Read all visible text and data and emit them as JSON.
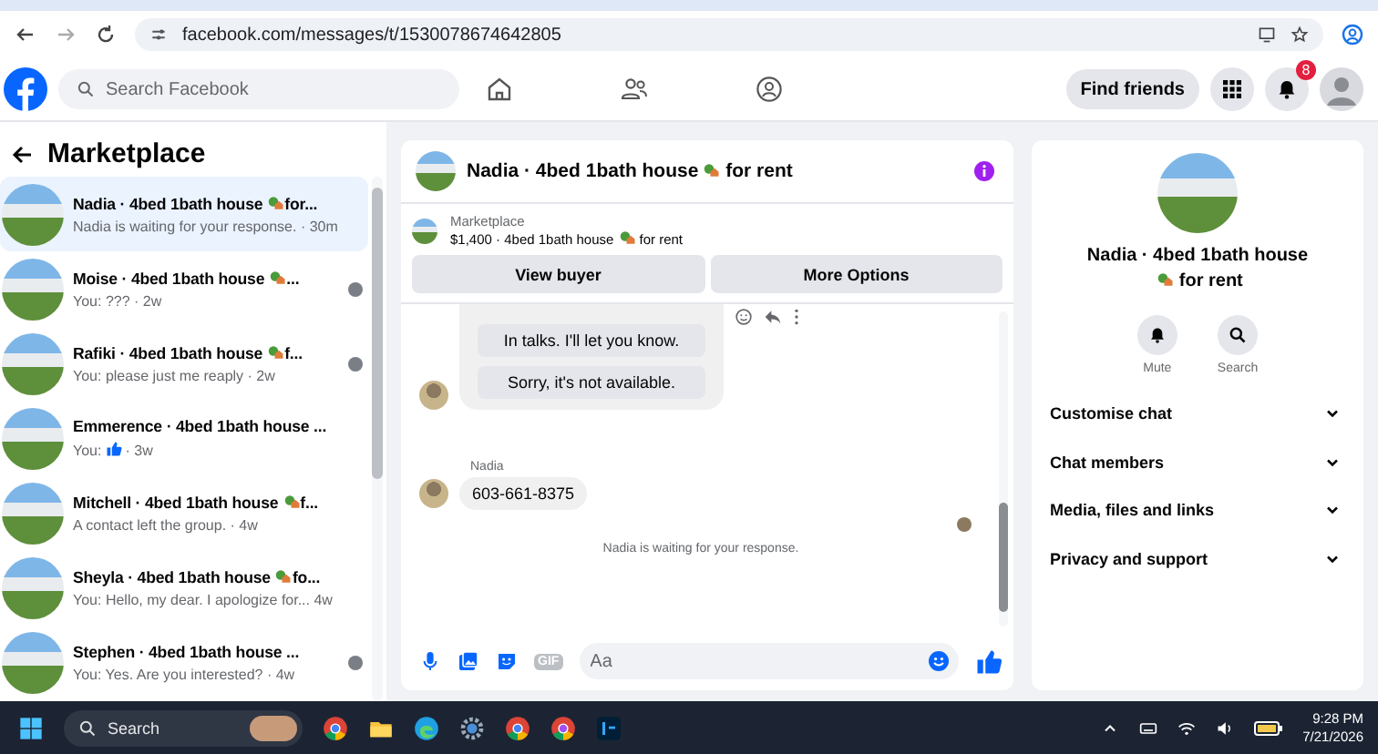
{
  "browser": {
    "url": "facebook.com/messages/t/1530078674642805"
  },
  "header": {
    "search_placeholder": "Search Facebook",
    "find_friends": "Find friends",
    "notification_count": "8"
  },
  "sidebar": {
    "title": "Marketplace",
    "conversations": [
      {
        "title": "Nadia · 4bed 1bath house",
        "emoji": true,
        "title_end": "for...",
        "preview": "Nadia is waiting for your response. · 30m",
        "like": false,
        "selected": true,
        "seen": false
      },
      {
        "title": "Moise · 4bed 1bath house",
        "emoji": true,
        "title_end": "...",
        "preview": "You: ??? · 2w",
        "like": false,
        "selected": false,
        "seen": true
      },
      {
        "title": "Rafiki · 4bed 1bath house",
        "emoji": true,
        "title_end": "f...",
        "preview": "You: please just me reaply · 2w",
        "like": false,
        "selected": false,
        "seen": true
      },
      {
        "title": "Emmerence · 4bed 1bath house ...",
        "emoji": false,
        "preview": "You:",
        "like": true,
        "preview_end": "· 3w",
        "selected": false,
        "seen": false
      },
      {
        "title": "Mitchell · 4bed 1bath house",
        "emoji": true,
        "title_end": "f...",
        "preview": "A contact left the group. · 4w",
        "like": false,
        "selected": false,
        "seen": false
      },
      {
        "title": "Sheyla · 4bed 1bath house",
        "emoji": true,
        "title_end": "fo...",
        "preview": "You: Hello, my dear. I apologize for... 4w",
        "like": false,
        "selected": false,
        "seen": false
      },
      {
        "title": "Stephen · 4bed 1bath house ...",
        "emoji": false,
        "preview": "You: Yes. Are you interested? · 4w",
        "like": false,
        "selected": false,
        "seen": true
      }
    ]
  },
  "chat": {
    "title": "Nadia · 4bed 1bath house",
    "title_end": "for rent",
    "listing": {
      "source": "Marketplace",
      "text": "$1,400 · 4bed 1bath house",
      "text_end": "for rent"
    },
    "buttons": [
      "View buyer",
      "More Options"
    ],
    "quick_replies": [
      "In talks. I'll let you know.",
      "Sorry, it's not available."
    ],
    "sender": "Nadia",
    "message": "603-661-8375",
    "status": "Nadia is waiting for your response.",
    "gif_label": "GIF",
    "placeholder": "Aa"
  },
  "details": {
    "title": "Nadia · 4bed 1bath house",
    "title_end": "for rent",
    "actions": [
      "Mute",
      "Search"
    ],
    "sections": [
      {
        "label": "Customise chat",
        "expanded": false
      },
      {
        "label": "Chat members",
        "expanded": false
      },
      {
        "label": "Media, files and links",
        "expanded": false
      },
      {
        "label": "Privacy and support",
        "expanded": false
      }
    ]
  },
  "taskbar": {
    "search": "Search",
    "time": "9:28 PM",
    "date": "7/21/2026"
  }
}
